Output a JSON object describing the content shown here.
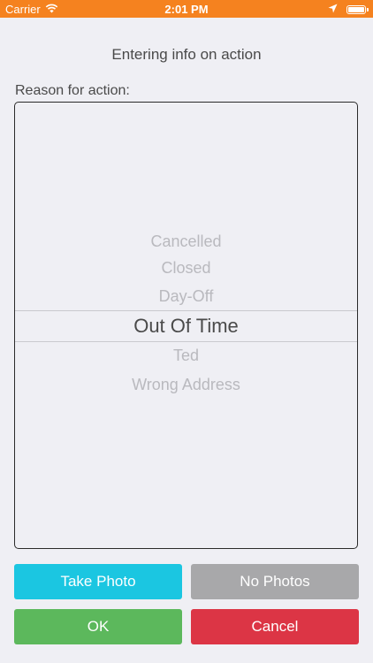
{
  "status_bar": {
    "carrier": "Carrier",
    "time": "2:01 PM",
    "background": "#f5821f",
    "icons": [
      "wifi-icon",
      "location-arrow-icon",
      "battery-icon"
    ]
  },
  "screen": {
    "title": "Entering info on action",
    "reason_label": "Reason for action:"
  },
  "picker": {
    "options": [
      "Cancelled",
      "Closed",
      "Day-Off",
      "Out Of Time",
      "Ted",
      "Wrong Address"
    ],
    "selected": "Out Of Time"
  },
  "buttons": {
    "take_photo": "Take Photo",
    "no_photos": "No Photos",
    "ok": "OK",
    "cancel": "Cancel"
  },
  "colors": {
    "take_photo": "#1bc6e1",
    "no_photos": "#a8a8aa",
    "ok": "#5cb85c",
    "cancel": "#dc3545"
  }
}
